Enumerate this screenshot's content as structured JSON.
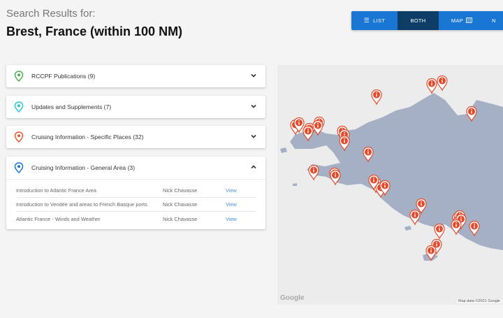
{
  "header": {
    "subtitle": "Search Results for:",
    "title": "Brest, France (within 100 NM)"
  },
  "view_toggle": {
    "list": "LIST",
    "both": "BOTH",
    "map": "MAP",
    "next": "N",
    "active": "both"
  },
  "panels": [
    {
      "label": "RCCPF Publications (9)",
      "pin_color": "#4caf50",
      "expanded": false
    },
    {
      "label": "Updates and Supplements (7)",
      "pin_color": "#26c6da",
      "expanded": false
    },
    {
      "label": "Cruising Information - Specific Places (32)",
      "pin_color": "#e8542b",
      "expanded": false
    },
    {
      "label": "Cruising Information - General Area (3)",
      "pin_color": "#1976d2",
      "expanded": true
    }
  ],
  "general_area_rows": [
    {
      "title": "Introduction to Atlantic France Area",
      "author": "Nick Chavasse",
      "link": "View"
    },
    {
      "title": "Introduction to Vendée and areas to French Basque ports",
      "author": "Nick Chavasse",
      "link": "View"
    },
    {
      "title": "Atlantic France - Winds and Weather",
      "author": "Nick Chavasse",
      "link": "View"
    }
  ],
  "map": {
    "logo": "Google",
    "attribution": "Map data ©2021 Google",
    "marker_count": 32,
    "marker_color": "#e14b2c",
    "land_color": "#a6b0c4"
  }
}
